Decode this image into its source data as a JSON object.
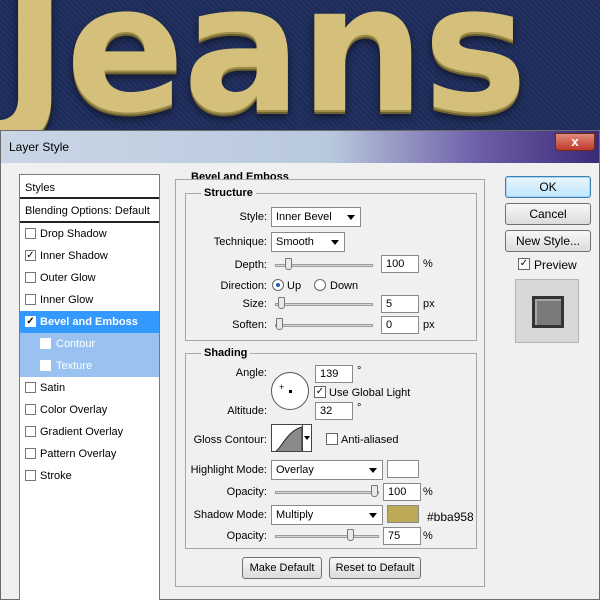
{
  "canvas": {
    "text": "Jeans"
  },
  "dialog": {
    "title": "Layer Style",
    "close": "x"
  },
  "sidebar": {
    "header": "Styles",
    "blending": "Blending Options: Default",
    "items": [
      {
        "label": "Drop Shadow",
        "checked": false
      },
      {
        "label": "Inner Shadow",
        "checked": true
      },
      {
        "label": "Outer Glow",
        "checked": false
      },
      {
        "label": "Inner Glow",
        "checked": false
      },
      {
        "label": "Bevel and Emboss",
        "checked": true
      },
      {
        "label": "Contour",
        "checked": false
      },
      {
        "label": "Texture",
        "checked": false
      },
      {
        "label": "Satin",
        "checked": false
      },
      {
        "label": "Color Overlay",
        "checked": false
      },
      {
        "label": "Gradient Overlay",
        "checked": false
      },
      {
        "label": "Pattern Overlay",
        "checked": false
      },
      {
        "label": "Stroke",
        "checked": false
      }
    ]
  },
  "bevel": {
    "title": "Bevel and Emboss",
    "structure": {
      "title": "Structure",
      "style_label": "Style:",
      "style_value": "Inner Bevel",
      "technique_label": "Technique:",
      "technique_value": "Smooth",
      "depth_label": "Depth:",
      "depth_value": "100",
      "depth_unit": "%",
      "depth_level": 0.1,
      "direction_label": "Direction:",
      "dir_up": "Up",
      "dir_down": "Down",
      "size_label": "Size:",
      "size_value": "5",
      "size_unit": "px",
      "size_level": 0.02,
      "soften_label": "Soften:",
      "soften_value": "0",
      "soften_unit": "px",
      "soften_level": 0.0
    },
    "shading": {
      "title": "Shading",
      "angle_label": "Angle:",
      "angle_value": "139",
      "angle_unit": "°",
      "global_light": "Use Global Light",
      "altitude_label": "Altitude:",
      "altitude_value": "32",
      "altitude_unit": "°",
      "gloss_label": "Gloss Contour:",
      "anti_aliased": "Anti-aliased",
      "highlight_label": "Highlight Mode:",
      "highlight_value": "Overlay",
      "highlight_color": "#ffffff",
      "h_opacity_label": "Opacity:",
      "h_opacity_value": "100",
      "h_opacity_unit": "%",
      "h_opacity_level": 1.0,
      "shadow_label": "Shadow Mode:",
      "shadow_value": "Multiply",
      "shadow_color": "#bba958",
      "shadow_hex": "#bba958",
      "s_opacity_label": "Opacity:",
      "s_opacity_value": "75",
      "s_opacity_unit": "%",
      "s_opacity_level": 0.75
    },
    "make_default": "Make Default",
    "reset_default": "Reset to Default"
  },
  "buttons": {
    "ok": "OK",
    "cancel": "Cancel",
    "new_style": "New Style...",
    "preview": "Preview"
  }
}
